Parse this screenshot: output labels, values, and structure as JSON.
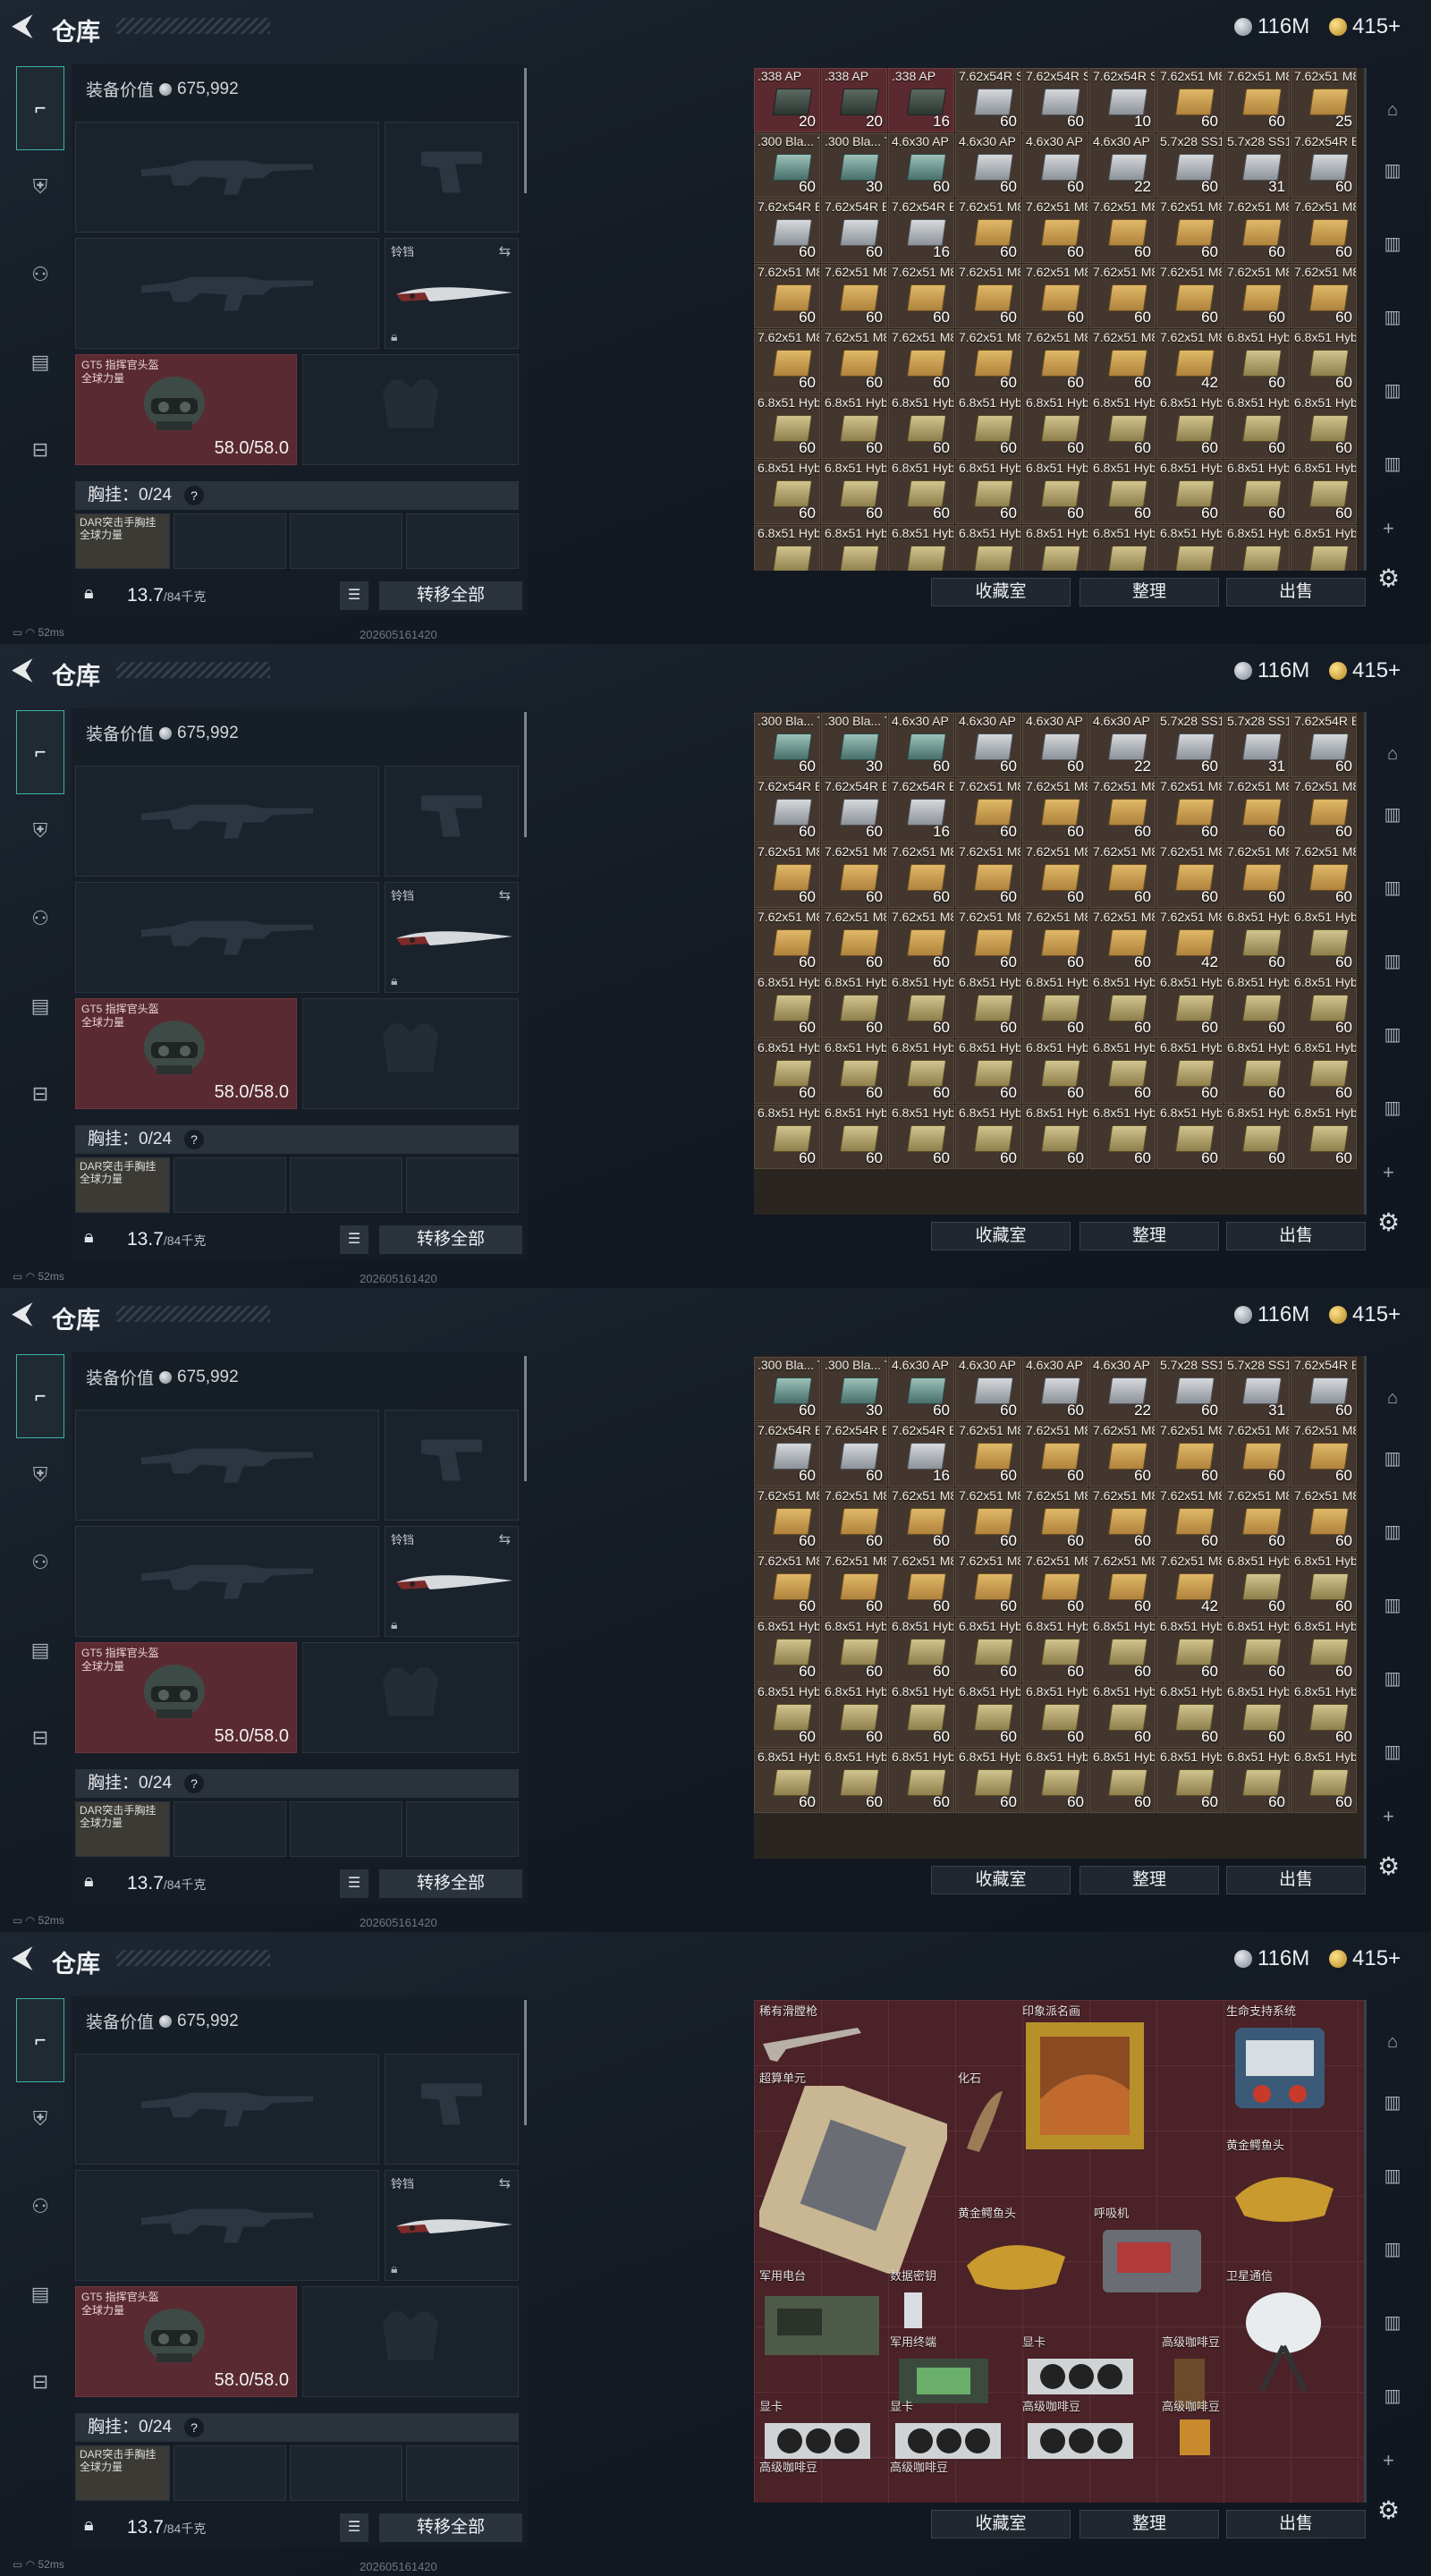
{
  "header": {
    "title": "仓库",
    "silver": "116M",
    "gold": "415+"
  },
  "equip": {
    "value_label": "装备价值",
    "value": "675,992"
  },
  "melee_label": "铃铛",
  "helmet": {
    "name": "GT5 指挥官头盔\n全球力量",
    "durability": "58.0/58.0"
  },
  "chest": {
    "label": "胸挂",
    "value": "0/24",
    "help": "?"
  },
  "vest_name": "DAR突击手胸挂 全球力量",
  "weight": {
    "value": "13.7",
    "max": "/84千克"
  },
  "transfer_label": "转移全部",
  "status": {
    "ping": "52ms",
    "stamp": "202605161420"
  },
  "actions": [
    "收藏室",
    "整理",
    "出售"
  ],
  "ammo_rows": [
    [
      [
        ".338 AP",
        "20",
        "dark"
      ],
      [
        ".338 AP",
        "20",
        "dark"
      ],
      [
        ".338 AP",
        "16",
        "dark"
      ],
      [
        "7.62x54R SNB",
        "60",
        "grey"
      ],
      [
        "7.62x54R SNB",
        "60",
        "grey"
      ],
      [
        "7.62x54R SNB",
        "10",
        "grey"
      ],
      [
        "7.62x51 M80",
        "60",
        "tan"
      ],
      [
        "7.62x51 M80",
        "60",
        "tan"
      ],
      [
        "7.62x51 M80",
        "25",
        "tan"
      ]
    ],
    [
      [
        ".300 Bla... Tac",
        "60",
        "teal"
      ],
      [
        ".300 Bla... Tac",
        "30",
        "teal"
      ],
      [
        "4.6x30 AP",
        "60",
        "teal"
      ],
      [
        "4.6x30 AP",
        "60",
        "grey"
      ],
      [
        "4.6x30 AP",
        "60",
        "grey"
      ],
      [
        "4.6x30 AP",
        "22",
        "grey"
      ],
      [
        "5.7x28 SS190",
        "60",
        "grey"
      ],
      [
        "5.7x28 SS190",
        "31",
        "grey"
      ],
      [
        "7.62x54R BT",
        "60",
        "grey"
      ]
    ],
    [
      [
        "7.62x54R BT",
        "60",
        "grey"
      ],
      [
        "7.62x54R BT",
        "60",
        "grey"
      ],
      [
        "7.62x54R BT",
        "16",
        "grey"
      ],
      [
        "7.62x51 M80",
        "60",
        "tan"
      ],
      [
        "7.62x51 M80",
        "60",
        "tan"
      ],
      [
        "7.62x51 M80",
        "60",
        "tan"
      ],
      [
        "7.62x51 M80",
        "60",
        "tan"
      ],
      [
        "7.62x51 M80",
        "60",
        "tan"
      ],
      [
        "7.62x51 M80",
        "60",
        "tan"
      ]
    ],
    [
      [
        "7.62x51 M80",
        "60",
        "tan"
      ],
      [
        "7.62x51 M80",
        "60",
        "tan"
      ],
      [
        "7.62x51 M80",
        "60",
        "tan"
      ],
      [
        "7.62x51 M80",
        "60",
        "tan"
      ],
      [
        "7.62x51 M80",
        "60",
        "tan"
      ],
      [
        "7.62x51 M80",
        "60",
        "tan"
      ],
      [
        "7.62x51 M80",
        "60",
        "tan"
      ],
      [
        "7.62x51 M80",
        "60",
        "tan"
      ],
      [
        "7.62x51 M80",
        "60",
        "tan"
      ]
    ],
    [
      [
        "7.62x51 M80",
        "60",
        "tan"
      ],
      [
        "7.62x51 M80",
        "60",
        "tan"
      ],
      [
        "7.62x51 M80",
        "60",
        "tan"
      ],
      [
        "7.62x51 M80",
        "60",
        "tan"
      ],
      [
        "7.62x51 M80",
        "60",
        "tan"
      ],
      [
        "7.62x51 M80",
        "60",
        "tan"
      ],
      [
        "7.62x51 M80",
        "42",
        "tan"
      ],
      [
        "6.8x51 Hybrid",
        "60",
        "olive"
      ],
      [
        "6.8x51 Hybrid",
        "60",
        "olive"
      ]
    ],
    [
      [
        "6.8x51 Hybrid",
        "60",
        "olive"
      ],
      [
        "6.8x51 Hybrid",
        "60",
        "olive"
      ],
      [
        "6.8x51 Hybrid",
        "60",
        "olive"
      ],
      [
        "6.8x51 Hybrid",
        "60",
        "olive"
      ],
      [
        "6.8x51 Hybrid",
        "60",
        "olive"
      ],
      [
        "6.8x51 Hybrid",
        "60",
        "olive"
      ],
      [
        "6.8x51 Hybrid",
        "60",
        "olive"
      ],
      [
        "6.8x51 Hybrid",
        "60",
        "olive"
      ],
      [
        "6.8x51 Hybrid",
        "60",
        "olive"
      ]
    ],
    [
      [
        "6.8x51 Hybrid",
        "60",
        "olive"
      ],
      [
        "6.8x51 Hybrid",
        "60",
        "olive"
      ],
      [
        "6.8x51 Hybrid",
        "60",
        "olive"
      ],
      [
        "6.8x51 Hybrid",
        "60",
        "olive"
      ],
      [
        "6.8x51 Hybrid",
        "60",
        "olive"
      ],
      [
        "6.8x51 Hybrid",
        "60",
        "olive"
      ],
      [
        "6.8x51 Hybrid",
        "60",
        "olive"
      ],
      [
        "6.8x51 Hybrid",
        "60",
        "olive"
      ],
      [
        "6.8x51 Hybrid",
        "60",
        "olive"
      ]
    ],
    [
      [
        "6.8x51 Hybrid",
        "60",
        "olive"
      ],
      [
        "6.8x51 Hybrid",
        "60",
        "olive"
      ],
      [
        "6.8x51 Hybrid",
        "60",
        "olive"
      ],
      [
        "6.8x51 Hybrid",
        "60",
        "olive"
      ],
      [
        "6.8x51 Hybrid",
        "60",
        "olive"
      ],
      [
        "6.8x51 Hybrid",
        "60",
        "olive"
      ],
      [
        "6.8x51 Hybrid",
        "60",
        "olive"
      ],
      [
        "6.8x51 Hybrid",
        "60",
        "olive"
      ],
      [
        "6.8x51 Hybrid",
        "60",
        "olive"
      ]
    ]
  ],
  "collection_items": [
    {
      "name": "稀有滑膛枪"
    },
    {
      "name": "印象派名画"
    },
    {
      "name": "生命支持系统"
    },
    {
      "name": "超算单元"
    },
    {
      "name": "化石"
    },
    {
      "name": "黄金鳄鱼头"
    },
    {
      "name": "黄金鳄鱼头"
    },
    {
      "name": "呼吸机"
    },
    {
      "name": "军用电台"
    },
    {
      "name": "数据密钥"
    },
    {
      "name": "卫星通信"
    },
    {
      "name": "军用终端"
    },
    {
      "name": "显卡"
    },
    {
      "name": "高级咖啡豆"
    },
    {
      "name": "显卡"
    },
    {
      "name": "显卡"
    },
    {
      "name": "高级咖啡豆"
    },
    {
      "name": "高级咖啡豆"
    },
    {
      "name": "高级咖啡豆"
    },
    {
      "name": "高级咖啡豆"
    }
  ]
}
